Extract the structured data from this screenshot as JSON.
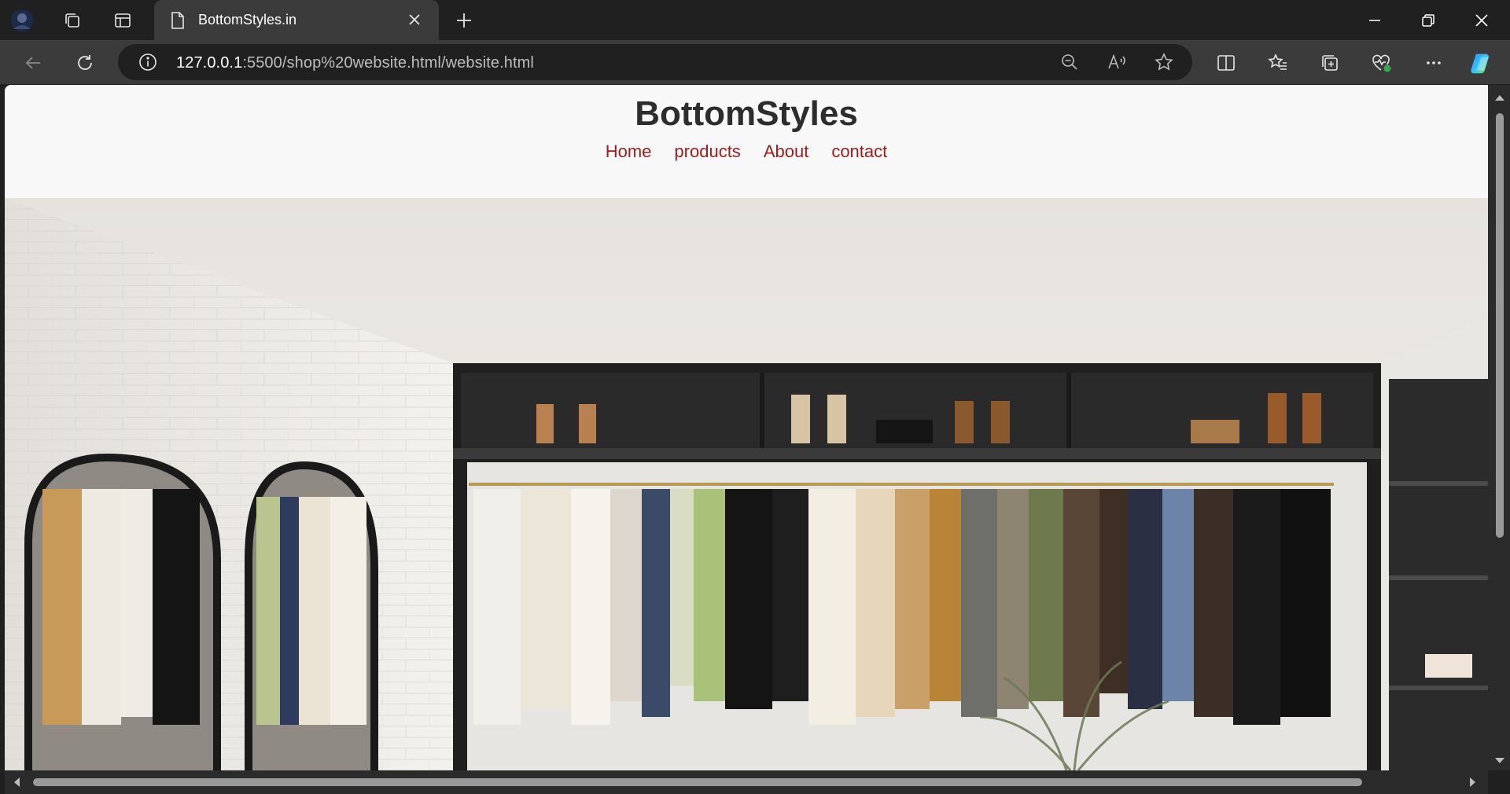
{
  "browser": {
    "tab_title": "BottomStyles.in",
    "url_host": "127.0.0.1",
    "url_path": ":5500/shop%20website.html/website.html"
  },
  "site": {
    "brand": "BottomStyles",
    "nav": [
      "Home",
      "products",
      "About",
      "contact"
    ],
    "colors": {
      "brand_text": "#2d2d2d",
      "nav_link": "#9b1c1c",
      "header_bg": "#f8f8f8"
    }
  },
  "icons": {
    "tabbar": [
      "profile-avatar-icon",
      "workspaces-icon",
      "tab-actions-icon",
      "new-tab-icon"
    ],
    "navbar": [
      "back-icon",
      "refresh-icon",
      "site-info-icon",
      "zoom-out-icon",
      "read-aloud-icon",
      "favorite-star-icon",
      "split-screen-icon",
      "favorites-icon",
      "collections-icon",
      "browser-essentials-icon",
      "more-icon",
      "copilot-icon"
    ],
    "window": [
      "minimize-icon",
      "restore-icon",
      "close-icon"
    ]
  }
}
